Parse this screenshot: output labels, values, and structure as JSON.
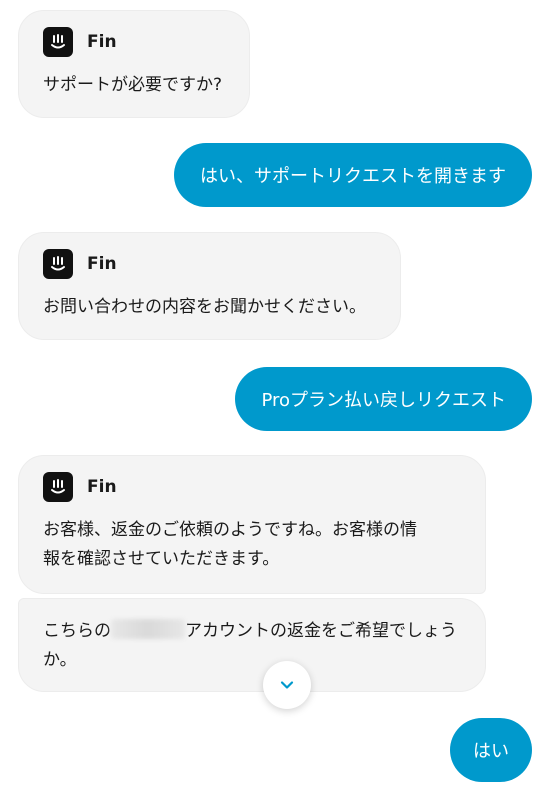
{
  "bot": {
    "name": "Fin",
    "logo_icon": "fin-logo-icon"
  },
  "messages": {
    "bot_1": "サポートが必要ですか?",
    "user_1": "はい、サポートリクエストを開きます",
    "bot_2": "お問い合わせの内容をお聞かせください。",
    "user_2": "Proプラン払い戻しリクエスト",
    "bot_3": "お客様、返金のご依頼のようですね。お客様の情\n報を確認させていただきます。",
    "bot_4_before": "こちらの",
    "bot_4_after": "アカウントの返金をご希望でしょう\nか。",
    "user_3": "はい"
  },
  "colors": {
    "user_bubble": "#0099cc",
    "bot_bubble": "#f4f4f4",
    "scroll_chevron": "#0099cc"
  },
  "controls": {
    "scroll_down_icon": "chevron-down-icon"
  }
}
